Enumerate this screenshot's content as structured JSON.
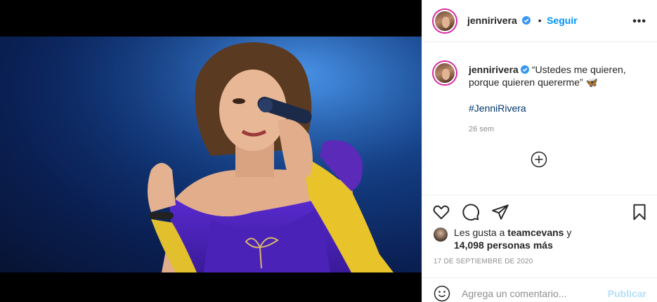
{
  "post": {
    "username": "jennirivera",
    "follow_label": "Seguir",
    "separator": "•",
    "more": "•••"
  },
  "caption": {
    "username": "jennirivera",
    "text": "“Ustedes me quieren, porque quieren quererme” 🦋",
    "hashtag": "#JenniRivera",
    "time_ago": "26 sem"
  },
  "icons": {
    "verified": "verified-badge-icon",
    "load_more": "plus-circle-icon",
    "like": "heart-icon",
    "comment": "comment-icon",
    "share": "paper-plane-icon",
    "save": "bookmark-icon",
    "emoji": "smiley-icon",
    "more": "more-dots-icon"
  },
  "likes": {
    "prefix": "Les gusta a ",
    "user": "teamcevans",
    "connector": " y",
    "count_text": "14,098 personas más"
  },
  "date": "17 DE SEPTIEMBRE DE 2020",
  "comment_box": {
    "placeholder": "Agrega un comentario...",
    "publish_label": "Publicar"
  },
  "colors": {
    "accent": "#0095f6",
    "hashtag": "#00376b",
    "muted": "#8e8e8e",
    "publish_disabled": "#b2dffc"
  }
}
